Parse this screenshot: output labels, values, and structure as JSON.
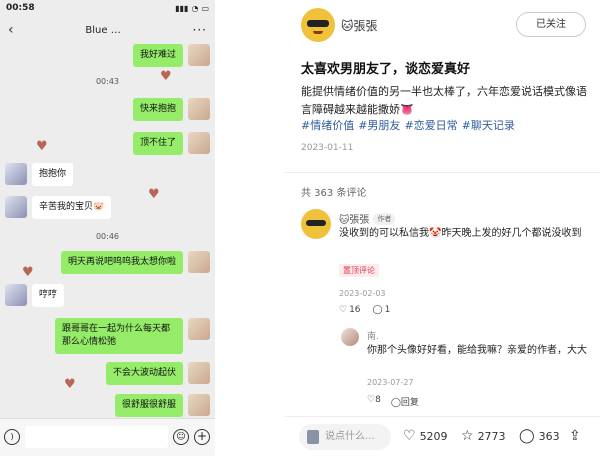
{
  "chat": {
    "status_time": "00:58",
    "title": "Blue",
    "title_suffix": "…",
    "back_icon": "chevron-left-icon",
    "messages": [
      {
        "side": "right",
        "text": "我好难过"
      },
      {
        "side": "right",
        "text": "快来抱抱"
      },
      {
        "side": "right",
        "text": "顶不住了"
      },
      {
        "side": "left",
        "text": "抱抱你"
      },
      {
        "side": "left",
        "text": "辛苦我的宝贝🐷"
      },
      {
        "side": "right",
        "text": "明天再说吧呜呜我太想你啦"
      },
      {
        "side": "left",
        "text": "哼哼"
      },
      {
        "side": "right",
        "text": "跟哥哥在一起为什么每天都那么心情松弛"
      },
      {
        "side": "right",
        "text": "不会大波动起伏"
      },
      {
        "side": "right",
        "text": "很舒服很舒服"
      }
    ],
    "timestamps": [
      "00:43",
      "00:46"
    ]
  },
  "post": {
    "author_name": "🐱張張",
    "follow_label": "已关注",
    "title": "太喜欢男朋友了，谈恋爱真好",
    "body": "能提供情绪价值的另一半也太棒了，六年恋爱说话模式像语言障碍越来越能撒娇👅",
    "tags": [
      "#情绪价值",
      "#男朋友",
      "#恋爱日常",
      "#聊天记录"
    ],
    "date": "2023-01-11",
    "comment_count_label": "共 363 条评论",
    "comments": [
      {
        "name": "🐱張張",
        "badge": "作者",
        "text": "没收到的可以私信我🤡昨天晚上发的好几个都说没收到",
        "pin_label": "置顶评论",
        "date": "2023-02-03",
        "likes": "16",
        "replies": "1"
      },
      {
        "name": "南.",
        "text": "你那个头像好好看，能给我嘛？亲爱的作者，大大",
        "date": "2023-07-27",
        "likes": "8",
        "reply_label": "回复"
      }
    ],
    "bottom": {
      "search_placeholder": "说点什么...",
      "likes": "5209",
      "stars": "2773",
      "comments": "363"
    }
  },
  "colors": {
    "bubble_right": "#95ec69",
    "bubble_left": "#ffffff",
    "tag_blue": "#2f5e9a",
    "pin_red": "#e2364b"
  }
}
